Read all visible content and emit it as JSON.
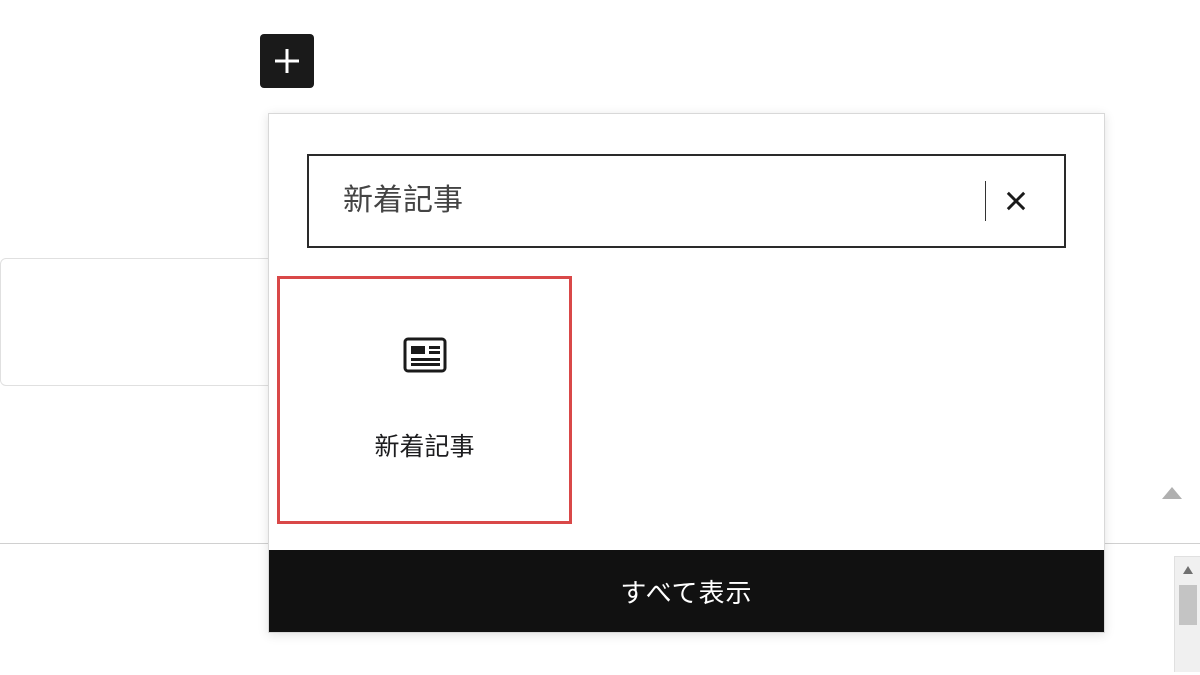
{
  "toolbar": {
    "add_icon": "plus-icon"
  },
  "inserter": {
    "search": {
      "value": "新着記事",
      "clear_icon": "close-icon"
    },
    "results": [
      {
        "icon": "newspaper-icon",
        "label": "新着記事"
      }
    ],
    "show_all_label": "すべて表示"
  }
}
